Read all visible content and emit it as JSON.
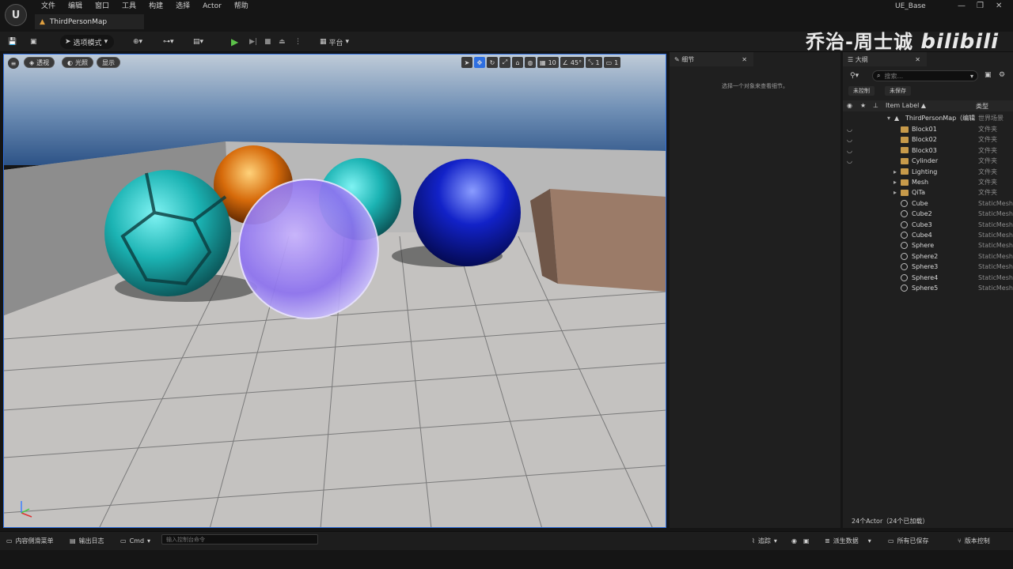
{
  "app": {
    "logo": "U",
    "project": "UE_Base"
  },
  "menu": [
    "文件",
    "编辑",
    "窗口",
    "工具",
    "构建",
    "选择",
    "Actor",
    "帮助"
  ],
  "tab": {
    "label": "ThirdPersonMap"
  },
  "watermark": "乔治-周士诚",
  "watermark2": "bilibili",
  "toolbar": {
    "mode": "选项模式",
    "platform": "平台"
  },
  "viewport": {
    "perspective": "透视",
    "lit": "光照",
    "show": "显示",
    "grid": "10",
    "angle": "45°",
    "scale": "1",
    "camera": "1"
  },
  "details": {
    "tab": "细节",
    "empty": "选择一个对象来查看细节。"
  },
  "outliner": {
    "tab": "大纲",
    "search_placeholder": "搜索...",
    "chip1": "未控制",
    "chip2": "未保存",
    "col_label": "Item Label ▲",
    "col_type": "类型",
    "root": {
      "label": "ThirdPersonMap（编辑",
      "type": "世界场景"
    },
    "items": [
      {
        "label": "Block01",
        "type": "文件夹",
        "kind": "folder"
      },
      {
        "label": "Block02",
        "type": "文件夹",
        "kind": "folder"
      },
      {
        "label": "Block03",
        "type": "文件夹",
        "kind": "folder"
      },
      {
        "label": "Cylinder",
        "type": "文件夹",
        "kind": "folder"
      },
      {
        "label": "Lighting",
        "type": "文件夹",
        "kind": "folder"
      },
      {
        "label": "Mesh",
        "type": "文件夹",
        "kind": "folder"
      },
      {
        "label": "QiTa",
        "type": "文件夹",
        "kind": "folder"
      },
      {
        "label": "Cube",
        "type": "StaticMeshActor",
        "kind": "mesh"
      },
      {
        "label": "Cube2",
        "type": "StaticMeshActor",
        "kind": "mesh"
      },
      {
        "label": "Cube3",
        "type": "StaticMeshActor",
        "kind": "mesh"
      },
      {
        "label": "Cube4",
        "type": "StaticMeshActor",
        "kind": "mesh"
      },
      {
        "label": "Sphere",
        "type": "StaticMeshActor",
        "kind": "mesh"
      },
      {
        "label": "Sphere2",
        "type": "StaticMeshActor",
        "kind": "mesh"
      },
      {
        "label": "Sphere3",
        "type": "StaticMeshActor",
        "kind": "mesh"
      },
      {
        "label": "Sphere4",
        "type": "StaticMeshActor",
        "kind": "mesh"
      },
      {
        "label": "Sphere5",
        "type": "StaticMeshActor",
        "kind": "mesh"
      }
    ],
    "footer": "24个Actor（24个已加载）"
  },
  "status": {
    "content_drawer": "内容侧滑菜单",
    "output_log": "输出日志",
    "cmd": "Cmd",
    "cmd_placeholder": "输入控制台命令",
    "trace": "追踪",
    "derived": "派生数据",
    "saved": "所有已保存",
    "source_control": "版本控制"
  }
}
